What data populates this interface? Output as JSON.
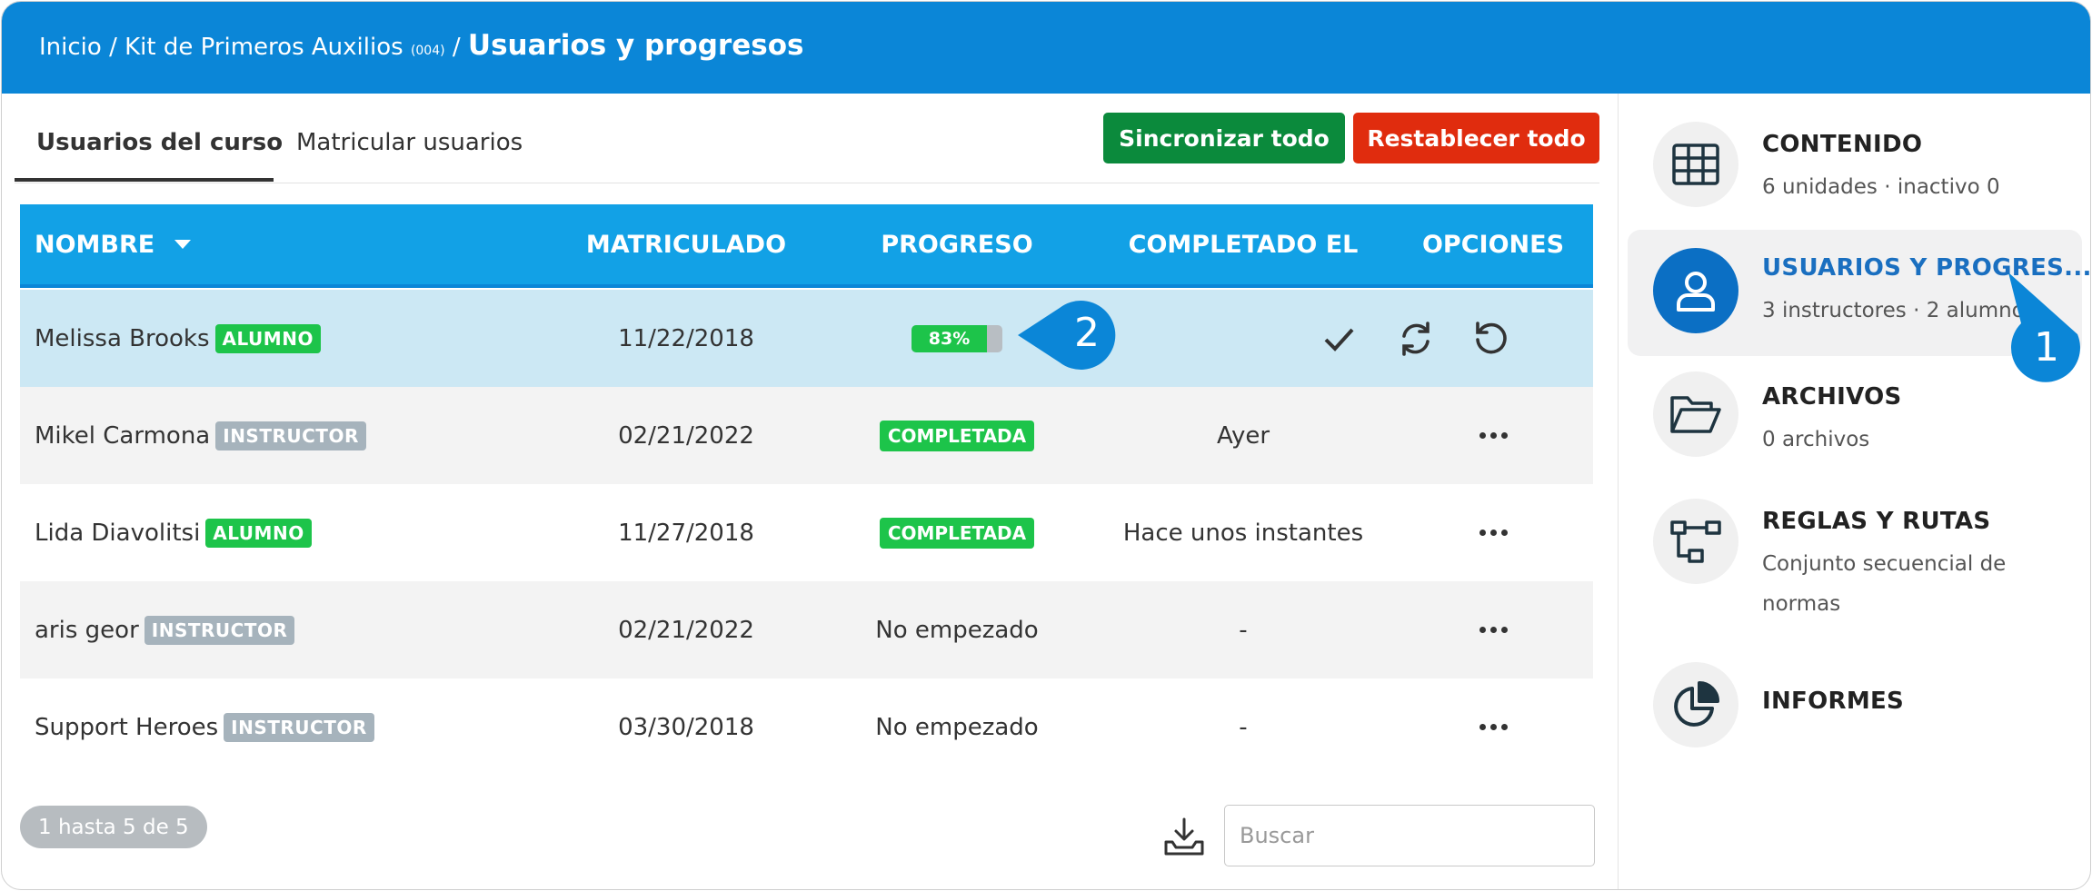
{
  "header": {
    "crumb_home": "Inicio",
    "sep1": "/",
    "crumb_course": "Kit de Primeros Auxilios",
    "crumb_code": "(004)",
    "sep2": "/",
    "crumb_current": "Usuarios y progresos"
  },
  "tabs": [
    {
      "label": "Usuarios del curso",
      "active": true
    },
    {
      "label": "Matricular usuarios",
      "active": false
    }
  ],
  "actions": {
    "sync_label": "Sincronizar todo",
    "reset_label": "Restablecer todo"
  },
  "table": {
    "headers": [
      "NOMBRE",
      "MATRICULADO",
      "PROGRESO",
      "COMPLETADO EL",
      "OPCIONES"
    ],
    "rows": [
      {
        "name": "Melissa Brooks",
        "role": "ALUMNO",
        "enrolled": "11/22/2018",
        "progress_text": "83%",
        "progress": 0.83,
        "completed": ""
      },
      {
        "name": "Mikel Carmona",
        "role": "INSTRUCTOR",
        "enrolled": "02/21/2022",
        "progress_text": "COMPLETADA",
        "completed": "Ayer"
      },
      {
        "name": "Lida Diavolitsi",
        "role": "ALUMNO",
        "enrolled": "11/27/2018",
        "progress_text": "COMPLETADA",
        "completed": "Hace unos instantes"
      },
      {
        "name": "aris geor",
        "role": "INSTRUCTOR",
        "enrolled": "02/21/2022",
        "progress_text": "No empezado",
        "completed": "-"
      },
      {
        "name": "Support Heroes",
        "role": "INSTRUCTOR",
        "enrolled": "03/30/2018",
        "progress_text": "No empezado",
        "completed": "-"
      }
    ]
  },
  "callouts": {
    "one": "1",
    "two": "2"
  },
  "footer": {
    "pager": "1 hasta 5 de 5",
    "search_placeholder": "Buscar"
  },
  "sidebar": {
    "items": [
      {
        "title": "CONTENIDO",
        "sub": "6 unidades · inactivo 0",
        "icon": "grid-icon"
      },
      {
        "title": "USUARIOS Y PROGRES...",
        "sub": "3 instructores · 2 alumnos",
        "icon": "user-icon",
        "active": true
      },
      {
        "title": "ARCHIVOS",
        "sub": "0 archivos",
        "icon": "folder-icon"
      },
      {
        "title": "REGLAS Y RUTAS",
        "sub": "Conjunto secuencial de normas",
        "icon": "flow-icon"
      },
      {
        "title": "INFORMES",
        "sub": "",
        "icon": "pie-chart-icon"
      }
    ]
  },
  "colors": {
    "header": "#0b86d7",
    "table_header": "#12a1e6",
    "green": "#1dc44a",
    "sync_button": "#0b8a3c",
    "reset_button": "#e02c0e",
    "badge_gray": "#a6b3bc",
    "highlight_row": "#cce8f4"
  }
}
